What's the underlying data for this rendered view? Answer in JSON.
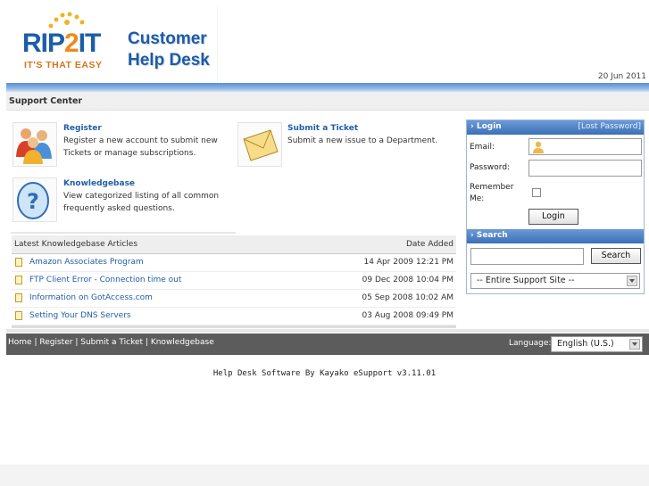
{
  "header": {
    "logo_text": "RIP",
    "logo_text_two": "2",
    "logo_text_end": "IT",
    "logo_tagline": "IT'S THAT EASY",
    "logo_title_line1": "Customer",
    "logo_title_line2": "Help Desk",
    "date": "20 Jun 2011"
  },
  "section": {
    "title": "Support Center"
  },
  "tiles": [
    {
      "title": "Register",
      "desc1": "Register a new account to submit new",
      "desc2": "Tickets or manage subscriptions."
    },
    {
      "title": "Submit a Ticket",
      "desc1": "Submit a new issue to a Department.",
      "desc2": ""
    },
    {
      "title": "Knowledgebase",
      "desc1": "View categorized listing of all common",
      "desc2": "frequently asked questions."
    }
  ],
  "kb": {
    "heading": "Latest Knowledgebase Articles",
    "date_heading": "Date Added",
    "rows": [
      {
        "title": "Amazon Associates Program",
        "date": "14 Apr 2009 12:21 PM"
      },
      {
        "title": "FTP Client Error - Connection time out",
        "date": "09 Dec 2008 10:04 PM"
      },
      {
        "title": "Information on GotAccess.com",
        "date": "05 Sep 2008 10:02 AM"
      },
      {
        "title": "Setting Your DNS Servers",
        "date": "03 Aug 2008 09:49 PM"
      }
    ]
  },
  "login": {
    "heading": "Login",
    "lost_password": "[Lost Password]",
    "email_label": "Email:",
    "password_label": "Password:",
    "remember_label1": "Remember",
    "remember_label2": "Me:",
    "button": "Login"
  },
  "search": {
    "heading": "Search",
    "button": "Search",
    "scope_selected": "-- Entire Support Site --"
  },
  "footer": {
    "links": [
      "Home",
      "Register",
      "Submit a Ticket",
      "Knowledgebase"
    ],
    "separator": "|",
    "language_label": "Language:",
    "language_selected": "English (U.S.)",
    "credit": "Help Desk Software By Kayako eSupport v3.11.01"
  }
}
